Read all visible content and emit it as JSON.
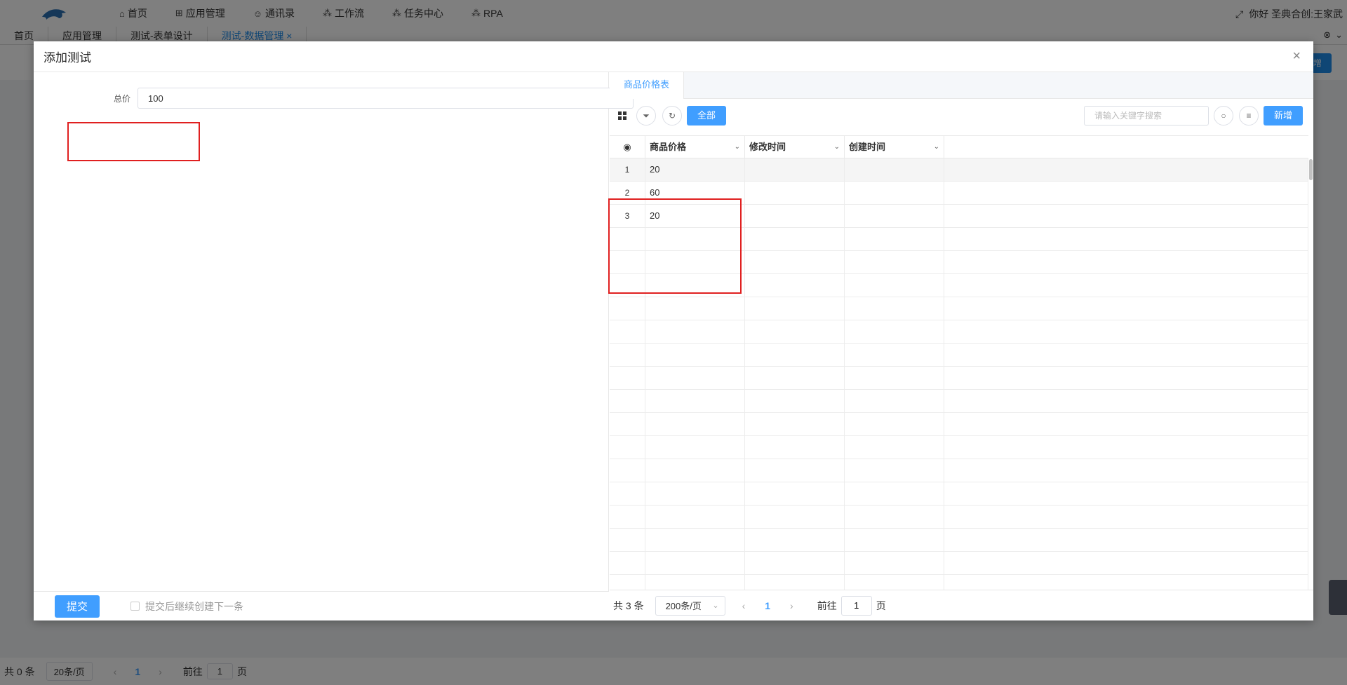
{
  "app": {
    "nav": [
      {
        "icon": "home-icon",
        "label": "首页"
      },
      {
        "icon": "apps-icon",
        "label": "应用管理"
      },
      {
        "icon": "contacts-icon",
        "label": "通讯录"
      },
      {
        "icon": "workflow-icon",
        "label": "工作流"
      },
      {
        "icon": "task-icon",
        "label": "任务中心"
      },
      {
        "icon": "rpa-icon",
        "label": "RPA"
      }
    ],
    "greeting": "你好 圣典合创:王家武",
    "tabs": [
      "首页",
      "应用管理",
      "测试-表单设计",
      "测试-数据管理"
    ],
    "active_tab_close": "×",
    "bg_new_label": "增",
    "bg_footer": {
      "total": "共 0 条",
      "page_size": "20条/页",
      "current_page": "1",
      "goto_label": "前往",
      "goto_value": "1",
      "page_label": "页"
    }
  },
  "dialog": {
    "title": "添加测试",
    "close": "×",
    "form": {
      "total_label": "总价",
      "total_value": "100"
    },
    "submit_label": "提交",
    "continue_label": "提交后继续创建下一条"
  },
  "subtable": {
    "tab_label": "商品价格表",
    "all_label": "全部",
    "search_placeholder": "请输入关键字搜索",
    "new_label": "新增",
    "columns": [
      "商品价格",
      "修改时间",
      "创建时间"
    ],
    "rows": [
      {
        "index": "1",
        "price": "20",
        "modified": "",
        "created": ""
      },
      {
        "index": "2",
        "price": "60",
        "modified": "",
        "created": ""
      },
      {
        "index": "3",
        "price": "20",
        "modified": "",
        "created": ""
      }
    ],
    "footer": {
      "total": "共 3 条",
      "page_size": "200条/页",
      "current_page": "1",
      "goto_label": "前往",
      "goto_value": "1",
      "page_label": "页"
    }
  },
  "colors": {
    "primary": "#409eff",
    "highlight": "#e02020"
  }
}
